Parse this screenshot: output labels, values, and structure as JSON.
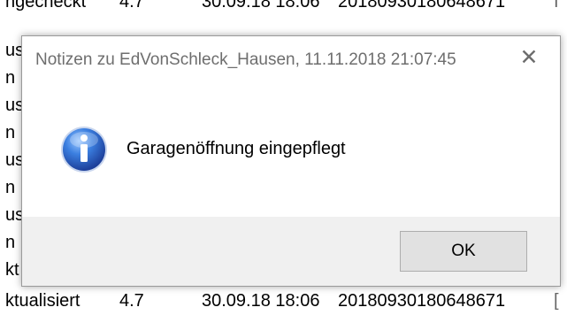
{
  "background_list": {
    "rows": [
      {
        "c1": "ngecheckt",
        "c2": "4.7",
        "c3": "30.09.18 18:06",
        "c4": "20180930180648671",
        "c5": "I"
      },
      {
        "c1": "us",
        "c2": "",
        "c3": "",
        "c4": "",
        "c5": "["
      },
      {
        "c1": "n",
        "c2": "",
        "c3": "",
        "c4": "",
        "c5": "["
      },
      {
        "c1": "us",
        "c2": "",
        "c3": "",
        "c4": "",
        "c5": "["
      },
      {
        "c1": "n",
        "c2": "",
        "c3": "",
        "c4": "",
        "c5": "["
      },
      {
        "c1": "us",
        "c2": "",
        "c3": "",
        "c4": "",
        "c5": "["
      },
      {
        "c1": "n",
        "c2": "",
        "c3": "",
        "c4": "",
        "c5": "["
      },
      {
        "c1": "us",
        "c2": "",
        "c3": "",
        "c4": "",
        "c5": "["
      },
      {
        "c1": "n",
        "c2": "",
        "c3": "",
        "c4": "",
        "c5": "["
      },
      {
        "c1": "kt",
        "c2": "",
        "c3": "",
        "c4": "",
        "c5": "["
      },
      {
        "c1": "ktualisiert",
        "c2": "4.7",
        "c3": "30.09.18 18:06",
        "c4": "20180930180648671",
        "c5": "["
      }
    ]
  },
  "dialog": {
    "title": "Notizen zu EdVonSchleck_Hausen, 11.11.2018 21:07:45",
    "close_glyph": "✕",
    "icon": "info-icon",
    "message": "Garagenöffnung eingepflegt",
    "ok_label": "OK"
  },
  "colors": {
    "icon_blue": "#2f6fd0",
    "footer_bg": "#f0f0f0",
    "button_bg": "#e1e1e1",
    "title_text": "#6e6e6e"
  }
}
